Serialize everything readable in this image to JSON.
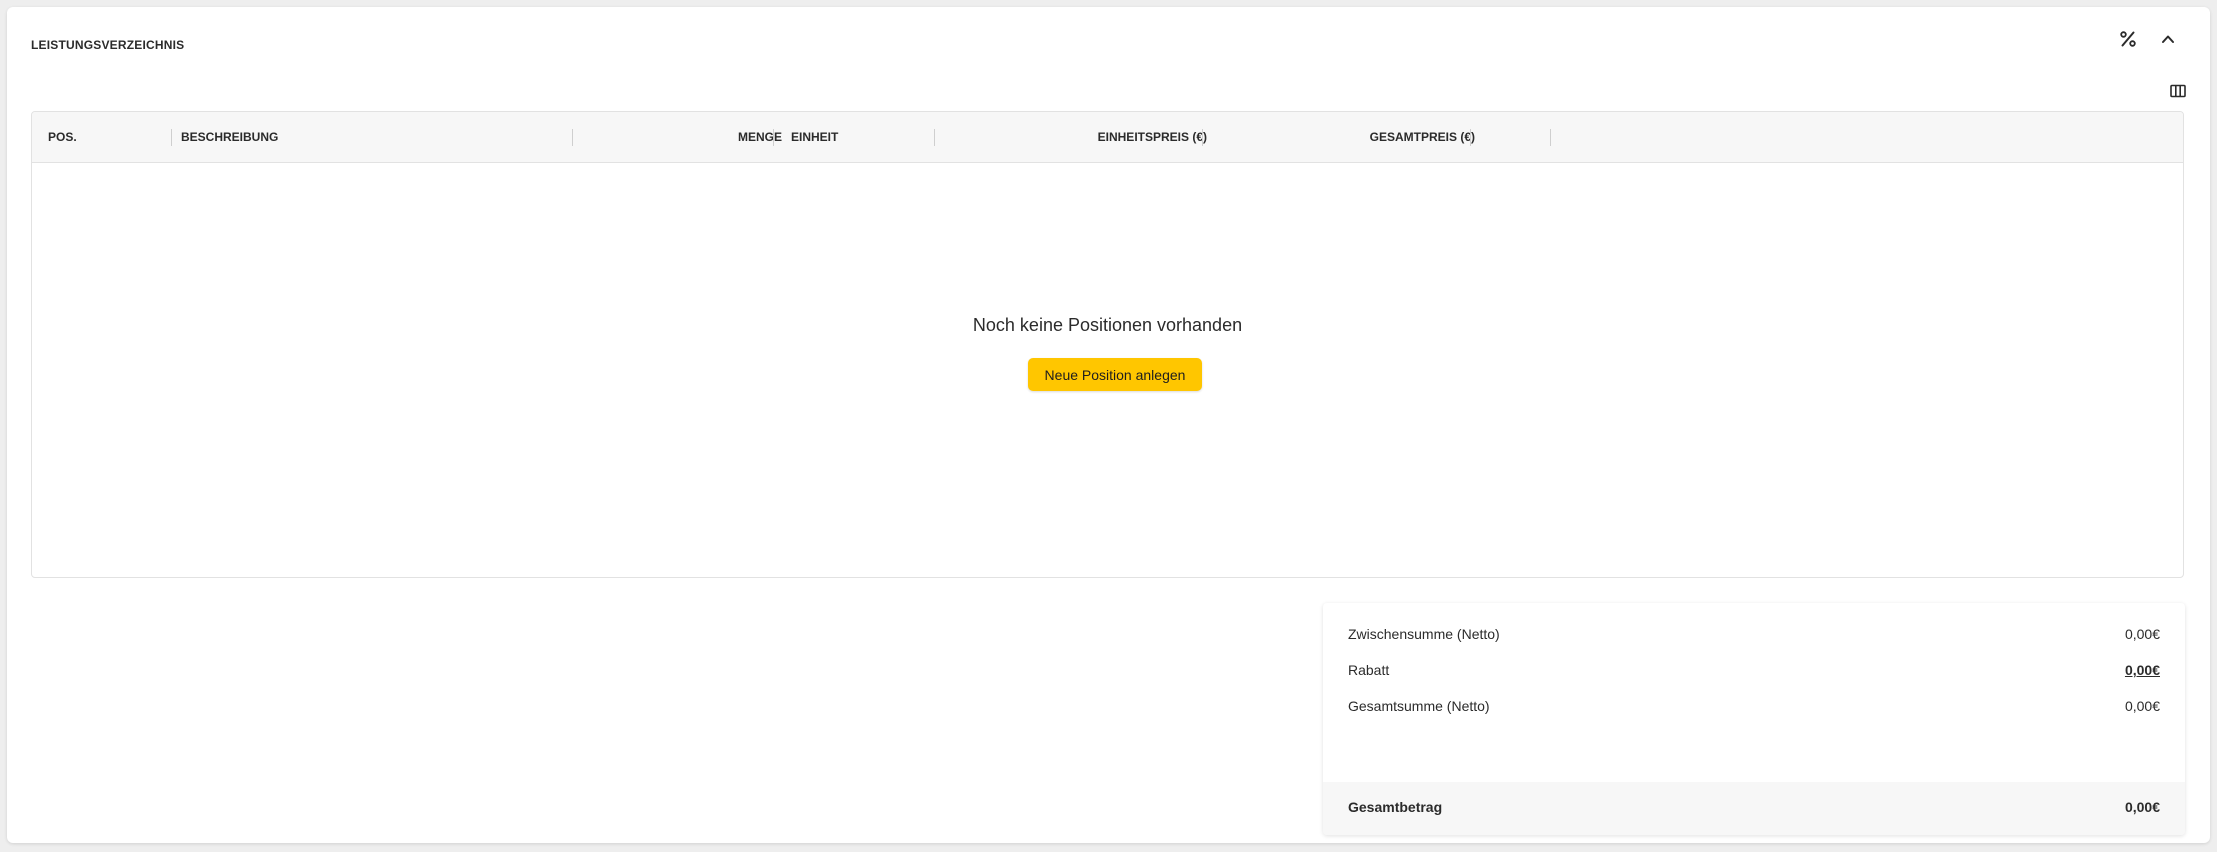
{
  "section": {
    "title": "LEISTUNGSVERZEICHNIS",
    "discount_icon": "percent-icon",
    "collapse_icon": "chevron-up-icon",
    "columns_icon": "columns-icon"
  },
  "table": {
    "columns": [
      {
        "label": "POS."
      },
      {
        "label": "BESCHREIBUNG"
      },
      {
        "label": "MENGE"
      },
      {
        "label": "EINHEIT"
      },
      {
        "label": "EINHEITSPREIS (€)"
      },
      {
        "label": "GESAMTPREIS (€)"
      }
    ],
    "empty_text": "Noch keine Positionen vorhanden",
    "new_button_label": "Neue Position anlegen"
  },
  "summary": {
    "subtotal_label": "Zwischensumme (Netto)",
    "subtotal_value": "0,00€",
    "discount_label": "Rabatt",
    "discount_value": "0,00€",
    "total_net_label": "Gesamtsumme (Netto)",
    "total_net_value": "0,00€",
    "grand_total_label": "Gesamtbetrag",
    "grand_total_value": "0,00€"
  },
  "colors": {
    "accent": "#ffc600",
    "header_bg": "#f7f7f7",
    "border": "#e2e2e2"
  }
}
